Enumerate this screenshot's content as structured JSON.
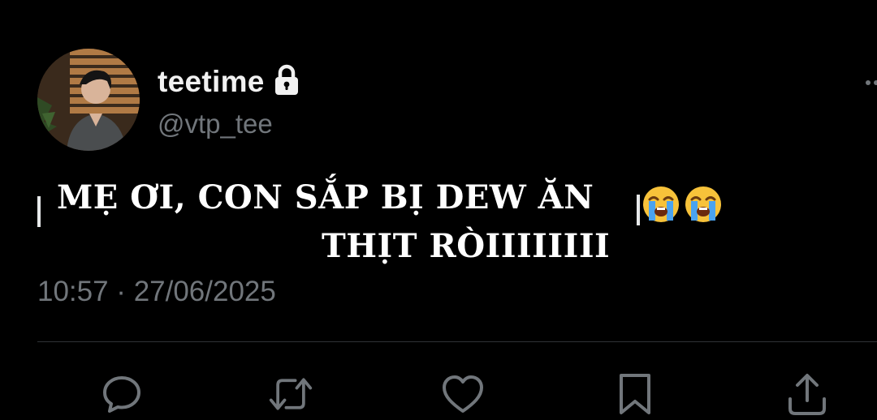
{
  "user": {
    "display_name": "teetime",
    "handle": "@vtp_tee",
    "avatar_icon": "profile-photo",
    "locked_icon": "lock-icon"
  },
  "tweet": {
    "caption_line1": "MẸ ƠI, CON SẮP BỊ DEW ĂN",
    "caption_line2": "THỊT RÒIIIIIIII",
    "emojis": [
      "loudly-crying-face",
      "loudly-crying-face"
    ],
    "timestamp": "10:57 · 27/06/2025"
  },
  "actions": [
    {
      "name": "reply",
      "icon": "comment-icon"
    },
    {
      "name": "retweet",
      "icon": "retweet-icon"
    },
    {
      "name": "like",
      "icon": "heart-icon"
    },
    {
      "name": "bookmark",
      "icon": "bookmark-icon"
    },
    {
      "name": "share",
      "icon": "share-icon"
    }
  ],
  "colors": {
    "background": "#000000",
    "primary_text": "#e7e9ea",
    "secondary_text": "#71767b",
    "divider": "#2f3336"
  }
}
